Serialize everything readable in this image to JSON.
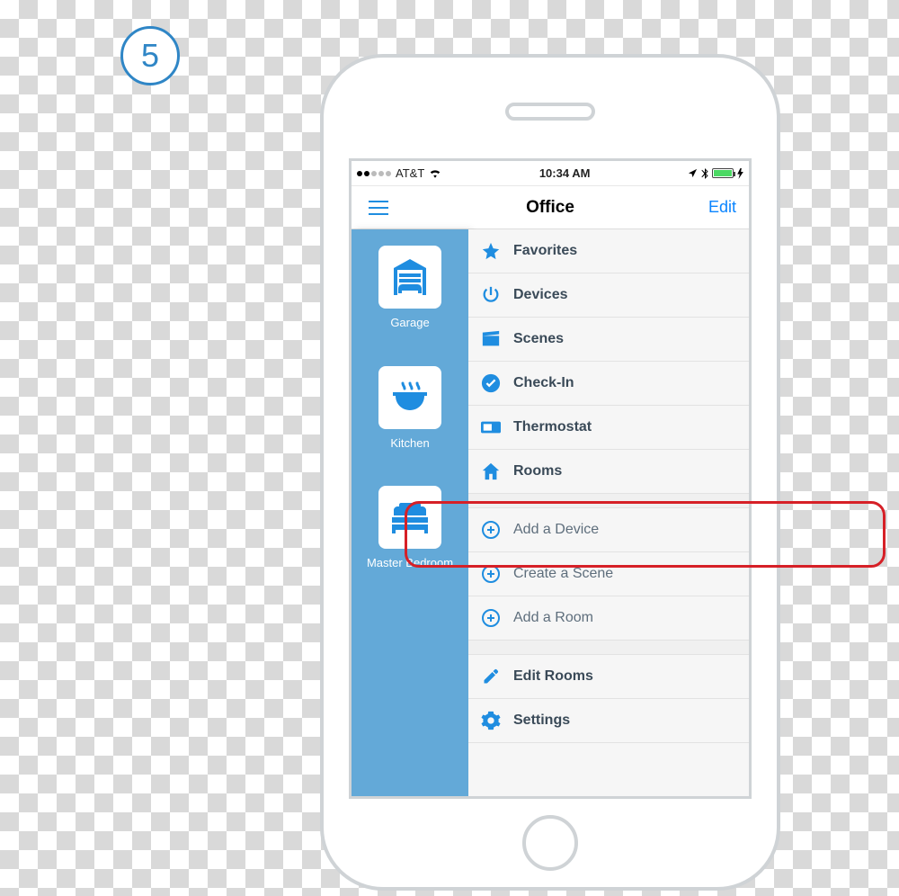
{
  "step_number": "5",
  "statusbar": {
    "carrier": "AT&T",
    "time": "10:34 AM"
  },
  "header": {
    "title": "Office",
    "edit": "Edit"
  },
  "sidebar": {
    "items": [
      {
        "label": "Garage",
        "icon": "garage-icon"
      },
      {
        "label": "Kitchen",
        "icon": "kitchen-icon"
      },
      {
        "label": "Master Bedroom",
        "icon": "bedroom-icon"
      }
    ]
  },
  "menu": {
    "primary": [
      {
        "label": "Favorites",
        "icon": "star-icon"
      },
      {
        "label": "Devices",
        "icon": "power-icon"
      },
      {
        "label": "Scenes",
        "icon": "clapper-icon"
      },
      {
        "label": "Check-In",
        "icon": "check-circle-icon"
      },
      {
        "label": "Thermostat",
        "icon": "thermostat-icon"
      },
      {
        "label": "Rooms",
        "icon": "home-icon"
      }
    ],
    "create": [
      {
        "label": "Add a Device",
        "icon": "plus-circle-icon"
      },
      {
        "label": "Create a Scene",
        "icon": "plus-circle-icon"
      },
      {
        "label": "Add a Room",
        "icon": "plus-circle-icon"
      }
    ],
    "system": [
      {
        "label": "Edit Rooms",
        "icon": "pencil-icon"
      },
      {
        "label": "Settings",
        "icon": "gear-icon"
      }
    ]
  },
  "highlight": "Add a Device"
}
